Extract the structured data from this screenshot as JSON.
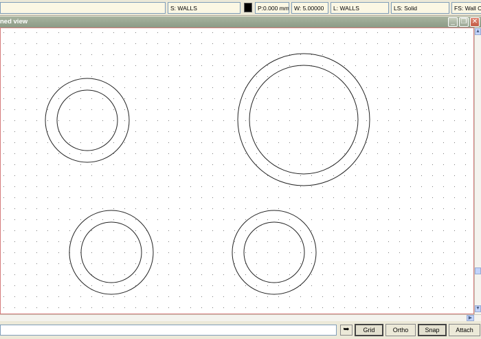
{
  "properties": {
    "style": "S: WALLS",
    "color": "#000000",
    "pen": "P:0.000 mm",
    "weight": "W: 5.00000",
    "layer": "L: WALLS",
    "line_style": "LS: Solid",
    "fill_style": "FS: Wall C"
  },
  "window": {
    "title": "ned view",
    "minimize_icon": "minimize-icon",
    "restore_icon": "restore-icon",
    "close_icon": "close-icon"
  },
  "scrollbars": {
    "up_icon": "arrow-up-icon",
    "down_icon": "arrow-down-icon",
    "right_icon": "arrow-right-icon"
  },
  "statusbar": {
    "command_value": "",
    "enter_icon": "enter-arrow-icon",
    "grid_label": "Grid",
    "ortho_label": "Ortho",
    "snap_label": "Snap",
    "attach_label": "Attach",
    "grid_on": true,
    "ortho_on": false,
    "snap_on": true,
    "attach_on": false
  }
}
